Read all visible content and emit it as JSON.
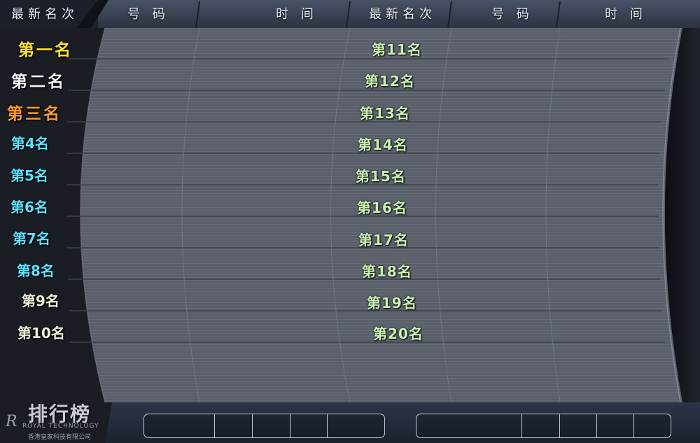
{
  "header": {
    "col_rank_left": "最新名次",
    "col_number_left": "号 码",
    "col_time_left": "时 间",
    "col_rank_right": "最新名次",
    "col_number_right": "号 码",
    "col_time_right": "时 间"
  },
  "ranks_left": [
    "第一名",
    "第二名",
    "第三名",
    "第4名",
    "第5名",
    "第6名",
    "第7名",
    "第8名",
    "第9名",
    "第10名"
  ],
  "ranks_right": [
    "第11名",
    "第12名",
    "第13名",
    "第14名",
    "第15名",
    "第16名",
    "第17名",
    "第18名",
    "第19名",
    "第20名"
  ],
  "footer": {
    "title": "排行榜",
    "logo_mark": "R",
    "logo_sub": "ROYAL TECHNOLOGY",
    "logo_cn": "香港皇家科技有限公司"
  },
  "colors": {
    "gold": "#ffe233",
    "white": "#f4f4f4",
    "orange": "#ff9a2e",
    "cyan": "#5fe0ff",
    "pale": "#eef0d8",
    "green": "#c9f2b3"
  }
}
